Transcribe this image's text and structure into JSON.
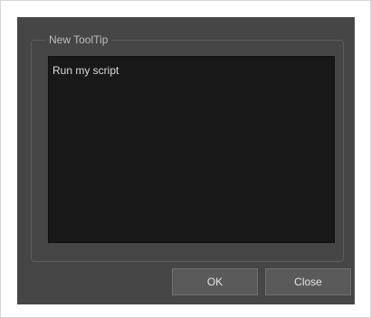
{
  "group": {
    "title": "New ToolTip"
  },
  "tooltip_editor": {
    "value": "Run my script"
  },
  "buttons": {
    "ok_label": "OK",
    "close_label": "Close"
  },
  "colors": {
    "dialog_background": "#464646",
    "editor_background": "#181818",
    "button_background": "#5a5a5a"
  }
}
